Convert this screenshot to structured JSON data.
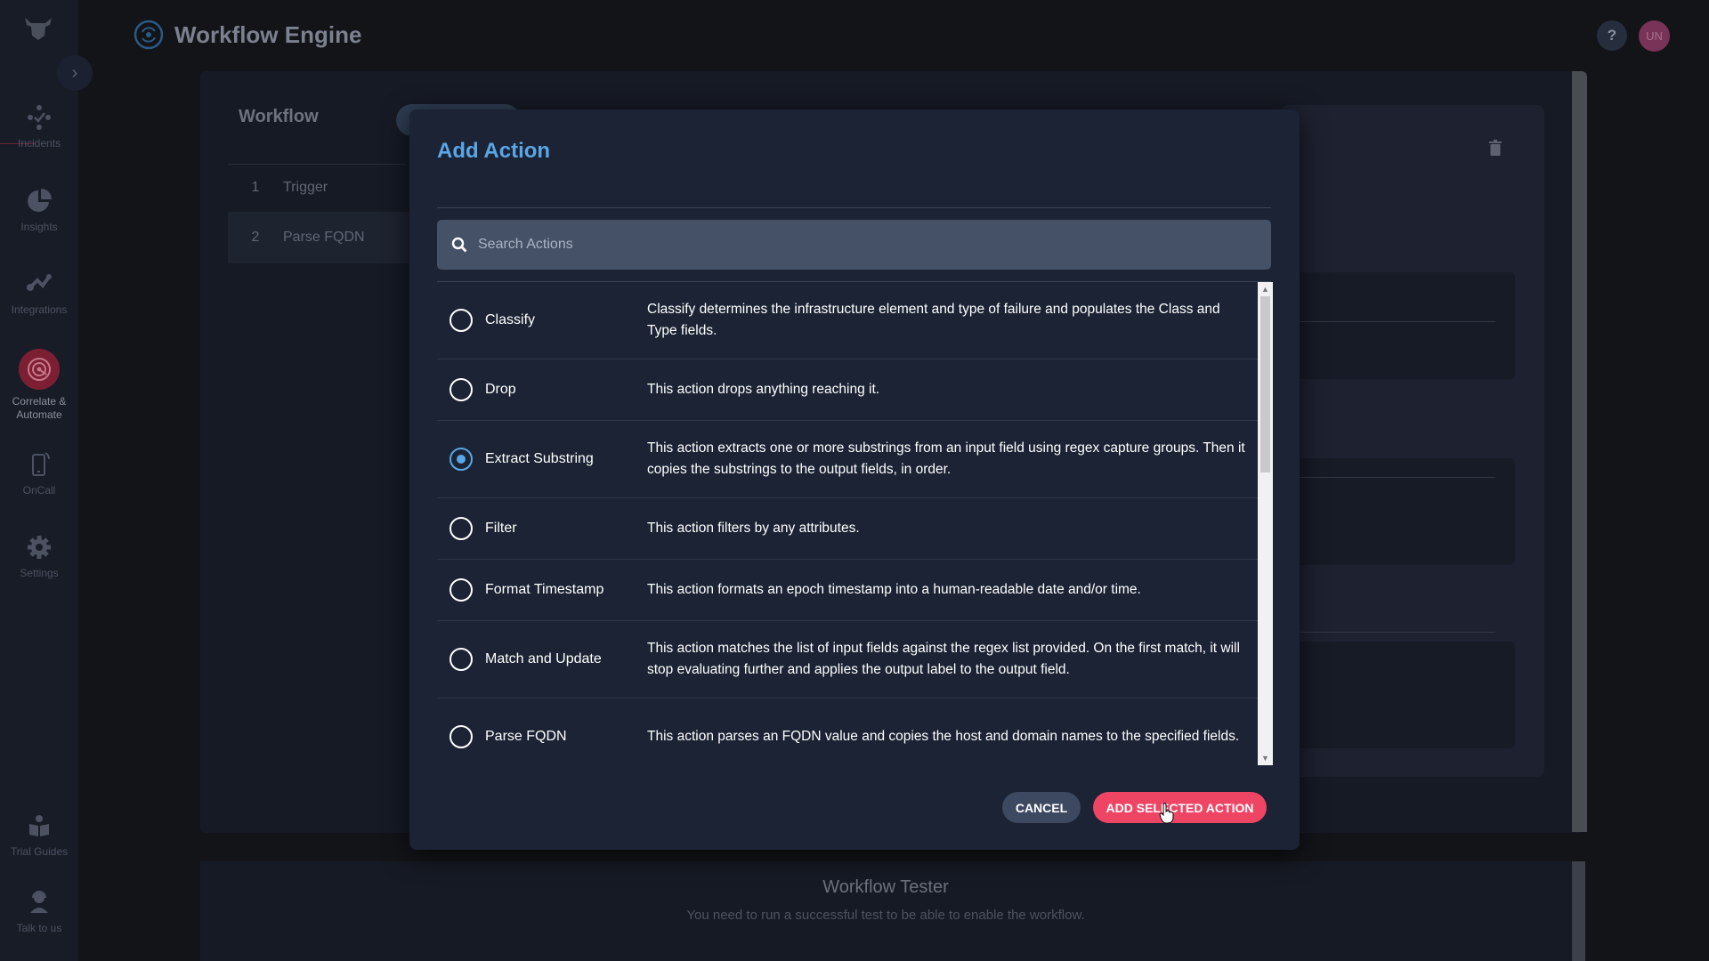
{
  "header": {
    "title": "Workflow Engine",
    "help_label": "?",
    "avatar_initials": "UN"
  },
  "sidebar": {
    "collapse_icon": "chevron-right-icon",
    "items": [
      {
        "label": "Incidents",
        "icon": "incidents-icon"
      },
      {
        "label": "Insights",
        "icon": "pie-chart-icon"
      },
      {
        "label": "Integrations",
        "icon": "integrations-icon"
      },
      {
        "label": "Correlate & Automate",
        "icon": "radar-icon",
        "active": true
      },
      {
        "label": "OnCall",
        "icon": "mobile-phone-icon"
      },
      {
        "label": "Settings",
        "icon": "gear-icon"
      },
      {
        "label": "Trial Guides",
        "icon": "book-icon"
      },
      {
        "label": "Talk to us",
        "icon": "support-agent-icon"
      }
    ]
  },
  "workflow": {
    "title": "Workflow",
    "steps": [
      {
        "num": "1",
        "label": "Trigger"
      },
      {
        "num": "2",
        "label": "Parse FQDN"
      }
    ]
  },
  "tester": {
    "title": "Workflow Tester",
    "subtitle": "You need to run a successful test to be able to enable the workflow."
  },
  "modal": {
    "title": "Add Action",
    "search_placeholder": "Search Actions",
    "search_value": "",
    "selected": "Extract Substring",
    "actions": [
      {
        "label": "Classify",
        "description": "Classify determines the infrastructure element and type of failure and populates the Class and Type fields.",
        "checked": false
      },
      {
        "label": "Drop",
        "description": "This action drops anything reaching it.",
        "checked": false
      },
      {
        "label": "Extract Substring",
        "description": "This action extracts one or more substrings from an input field using regex capture groups. Then it copies the substrings to the output fields, in order.",
        "checked": true
      },
      {
        "label": "Filter",
        "description": "This action filters by any attributes.",
        "checked": false
      },
      {
        "label": "Format Timestamp",
        "description": "This action formats an epoch timestamp into a human-readable date and/or time.",
        "checked": false
      },
      {
        "label": "Match and Update",
        "description": "This action matches the list of input fields against the regex list provided. On the first match, it will stop evaluating further and applies the output label to the output field.",
        "checked": false
      },
      {
        "label": "Parse FQDN",
        "description": "This action parses an FQDN value and copies the host and domain names to the specified fields.",
        "checked": false
      }
    ],
    "cancel_label": "CANCEL",
    "add_label": "ADD SELECTED ACTION"
  },
  "colors": {
    "accent_blue": "#5aa6e6",
    "primary_button": "#ef4565",
    "secondary_button": "#3d4960",
    "active_nav": "#7d1f33"
  }
}
